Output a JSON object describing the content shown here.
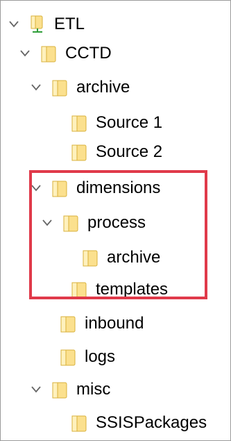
{
  "tree": {
    "items": [
      {
        "label": "ETL",
        "icon": "network-folder-icon",
        "expanded": true
      },
      {
        "label": "CCTD",
        "icon": "folder-icon",
        "expanded": true
      },
      {
        "label": "archive",
        "icon": "folder-icon",
        "expanded": true
      },
      {
        "label": "Source 1",
        "icon": "folder-icon",
        "expanded": false
      },
      {
        "label": "Source 2",
        "icon": "folder-icon",
        "expanded": false
      },
      {
        "label": "dimensions",
        "icon": "folder-icon",
        "expanded": true
      },
      {
        "label": "process",
        "icon": "folder-icon",
        "expanded": true
      },
      {
        "label": "archive",
        "icon": "folder-icon",
        "expanded": false
      },
      {
        "label": "templates",
        "icon": "folder-icon",
        "expanded": false
      },
      {
        "label": "inbound",
        "icon": "folder-icon",
        "expanded": false
      },
      {
        "label": "logs",
        "icon": "folder-icon",
        "expanded": false
      },
      {
        "label": "misc",
        "icon": "folder-icon",
        "expanded": true
      },
      {
        "label": "SSISPackages",
        "icon": "folder-icon",
        "expanded": false
      }
    ]
  },
  "colors": {
    "folder_fill": "#fbe08e",
    "folder_light": "#fff1bd",
    "folder_edge": "#d8b13b",
    "highlight": "#e03a4a",
    "network_base": "#2f9e3a",
    "chevron": "#666666"
  }
}
